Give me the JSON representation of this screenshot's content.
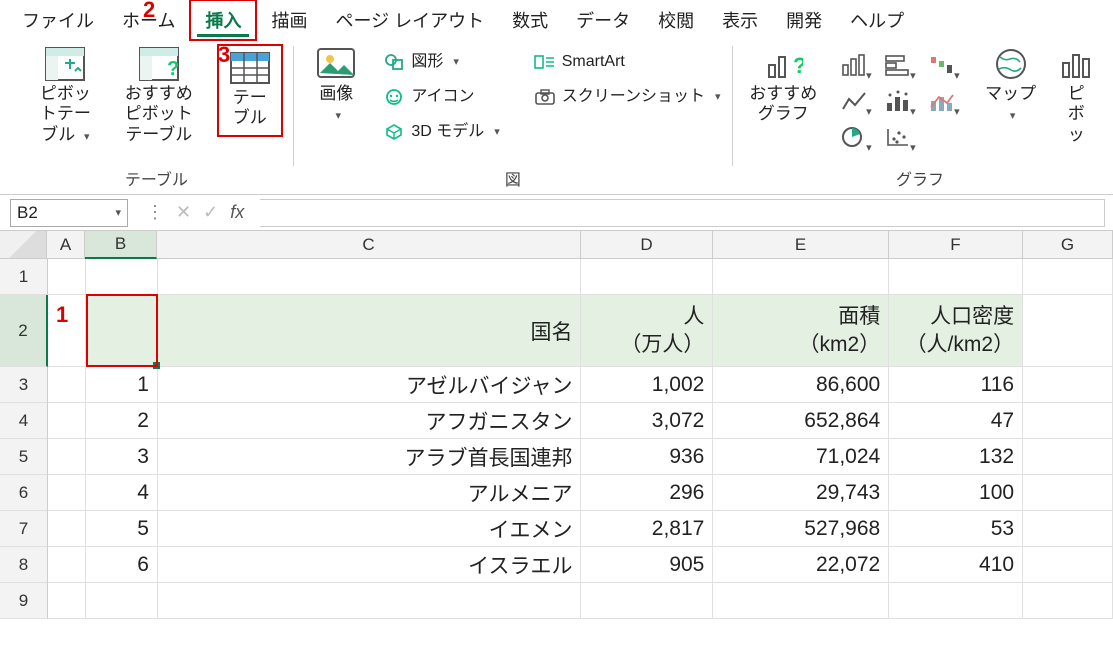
{
  "menu": {
    "items": [
      "ファイル",
      "ホーム",
      "挿入",
      "描画",
      "ページ レイアウト",
      "数式",
      "データ",
      "校閲",
      "表示",
      "開発",
      "ヘルプ"
    ],
    "active_index": 2
  },
  "annotations": {
    "one": "1",
    "two": "2",
    "three": "3"
  },
  "ribbon": {
    "tables": {
      "pivot": "ピボットテーブル",
      "recommended_pivot": "おすすめピボットテーブル",
      "table": "テーブル",
      "group_label": "テーブル"
    },
    "illustrations": {
      "pictures": "画像",
      "shapes": "図形",
      "icons": "アイコン",
      "models3d": "3D モデル",
      "smartart": "SmartArt",
      "screenshot": "スクリーンショット",
      "group_label": "図"
    },
    "charts": {
      "recommended": "おすすめグラフ",
      "maps": "マップ",
      "pivotchart_partial": "ピボッ",
      "group_label": "グラフ"
    }
  },
  "namebox": {
    "value": "B2"
  },
  "columns": [
    "A",
    "B",
    "C",
    "D",
    "E",
    "F",
    "G"
  ],
  "selected_col_index": 1,
  "row_nums": [
    "1",
    "2",
    "3",
    "4",
    "5",
    "6",
    "7",
    "8",
    "9"
  ],
  "selected_row_index": 1,
  "header_row": {
    "country": "国名",
    "pop": "人",
    "pop_unit": "（万人）",
    "area": "面積",
    "area_unit": "（km2）",
    "density": "人口密度",
    "density_unit": "（人/km2）"
  },
  "data_rows": [
    {
      "n": "1",
      "country": "アゼルバイジャン",
      "pop": "1,002",
      "area": "86,600",
      "density": "116"
    },
    {
      "n": "2",
      "country": "アフガニスタン",
      "pop": "3,072",
      "area": "652,864",
      "density": "47"
    },
    {
      "n": "3",
      "country": "アラブ首長国連邦",
      "pop": "936",
      "area": "71,024",
      "density": "132"
    },
    {
      "n": "4",
      "country": "アルメニア",
      "pop": "296",
      "area": "29,743",
      "density": "100"
    },
    {
      "n": "5",
      "country": "イエメン",
      "pop": "2,817",
      "area": "527,968",
      "density": "53"
    },
    {
      "n": "6",
      "country": "イスラエル",
      "pop": "905",
      "area": "22,072",
      "density": "410"
    }
  ]
}
